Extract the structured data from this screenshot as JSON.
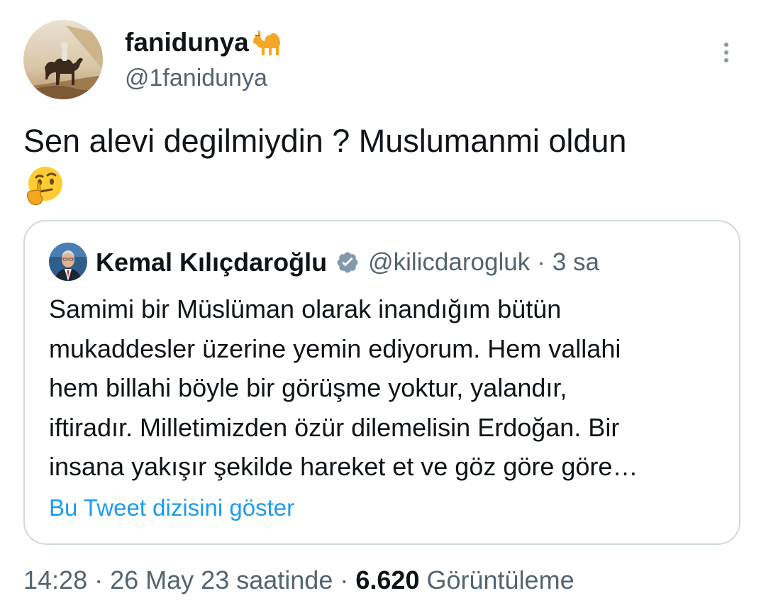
{
  "author": {
    "display_name": "fanidunya",
    "handle": "@1fanidunya",
    "name_emoji": "camel-icon",
    "avatar": "camel-rider-desert-avatar"
  },
  "tweet": {
    "text": "Sen alevi degilmiydin ? Muslumanmi oldun",
    "emoji": "thinking-face-icon"
  },
  "quoted_tweet": {
    "display_name": "Kemal Kılıçdaroğlu",
    "handle": "@kilicdarogluk",
    "separator": "·",
    "time": "3 sa",
    "verified_icon": "verified-badge-icon",
    "text_lines": [
      "Samimi bir Müslüman olarak inandığım bütün",
      "mukaddesler üzerine yemin ediyorum. Hem vallahi",
      "hem billahi böyle bir görüşme yoktur, yalandır,",
      "iftiradır. Milletimizden özür dilemelisin Erdoğan. Bir",
      "insana yakışır şekilde hareket et ve göz göre göre…"
    ],
    "show_thread_label": "Bu Tweet dizisini göster"
  },
  "meta": {
    "time": "14:28",
    "separator": "·",
    "date": "26 May 23 saatinde",
    "separator2": "·",
    "views_count": "6.620",
    "views_label": "Görüntüleme"
  },
  "colors": {
    "text": "#0f1419",
    "secondary": "#536471",
    "link": "#1d9bf0",
    "border": "#cfd9de",
    "verified_badge": "#829aab"
  }
}
